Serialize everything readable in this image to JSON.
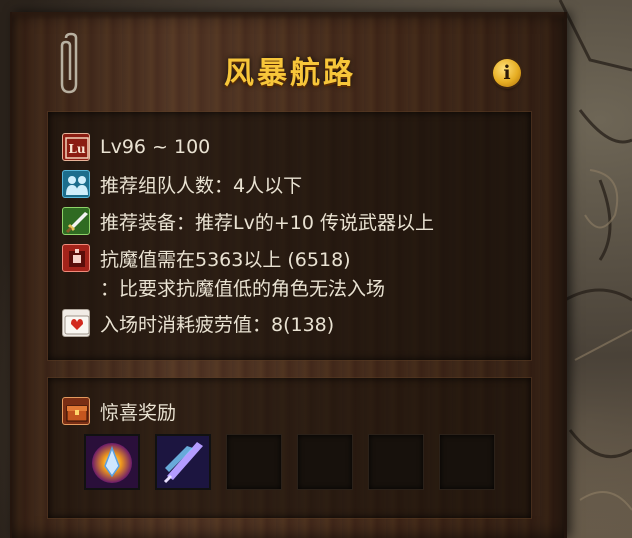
{
  "dungeon": {
    "title": "风暴航路",
    "info_icon_glyph": "i",
    "level_icon_text": "Lu"
  },
  "requirements": [
    {
      "icon": "level-badge-icon",
      "text": "Lv96 ~ 100"
    },
    {
      "icon": "party-members-icon",
      "text": "推荐组队人数：4人以下"
    },
    {
      "icon": "sword-icon",
      "text": "推荐装备：推荐Lv的+10 传说武器以上"
    },
    {
      "icon": "anti-magic-icon",
      "text": "抗魔值需在5363以上 (6518)",
      "subtext": "：比要求抗魔值低的角色无法入场"
    },
    {
      "icon": "fatigue-icon",
      "text": "入场时消耗疲劳值：8(138)"
    }
  ],
  "rewards": {
    "title": "惊喜奖励",
    "slots": [
      {
        "item": "orb-reward-icon",
        "filled": true
      },
      {
        "item": "crystal-blade-reward-icon",
        "filled": true
      },
      {
        "item": "",
        "filled": false
      },
      {
        "item": "",
        "filled": false
      },
      {
        "item": "",
        "filled": false
      },
      {
        "item": "",
        "filled": false
      }
    ]
  },
  "colors": {
    "title": "#f7c63a",
    "text": "#e9e2d2",
    "panel_wood": "#4a2f1f"
  }
}
